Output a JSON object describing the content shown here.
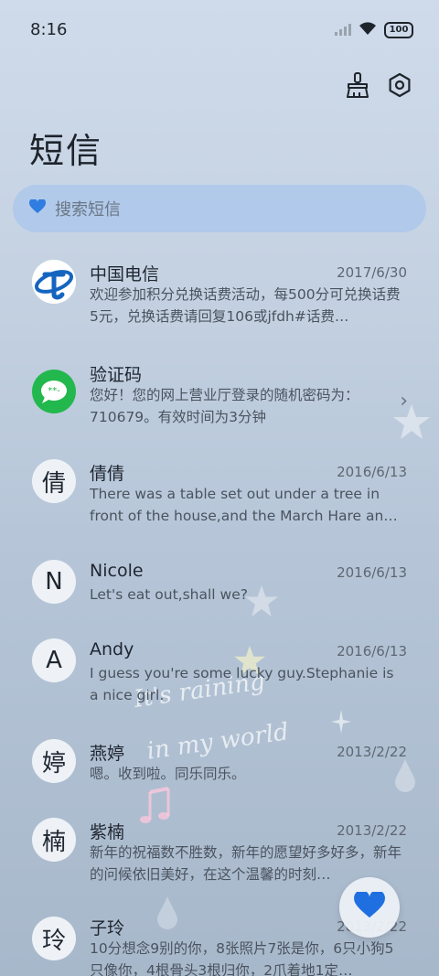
{
  "status_bar": {
    "time": "8:16",
    "battery": "100"
  },
  "header": {
    "title": "短信"
  },
  "search": {
    "placeholder": "搜索短信"
  },
  "decor": {
    "line1": "It's raining",
    "line2": "in my world"
  },
  "conversations": [
    {
      "name": "中国电信",
      "date": "2017/6/30",
      "preview": "欢迎参加积分兑换话费活动，每500分可兑换话费5元，兑换话费请回复106或jfdh#话费…",
      "avatar": ""
    },
    {
      "name": "验证码",
      "date": "",
      "preview": "您好！您的网上营业厅登录的随机密码为：710679。有效时间为3分钟",
      "avatar": ""
    },
    {
      "name": "倩倩",
      "date": "2016/6/13",
      "preview": "There was a table set out under a tree in front of the house,and the March Hare an…",
      "avatar": "倩"
    },
    {
      "name": "Nicole",
      "date": "2016/6/13",
      "preview": "Let's eat out,shall we?",
      "avatar": "N"
    },
    {
      "name": "Andy",
      "date": "2016/6/13",
      "preview": "I guess you're some lucky guy.Stephanie is a nice girl.",
      "avatar": "A"
    },
    {
      "name": "燕婷",
      "date": "2013/2/22",
      "preview": "嗯。收到啦。同乐同乐。",
      "avatar": "婷"
    },
    {
      "name": "紫楠",
      "date": "2013/2/22",
      "preview": "新年的祝福数不胜数，新年的愿望好多好多，新年的问候依旧美好，在这个温馨的时刻…",
      "avatar": "楠"
    },
    {
      "name": "子玲",
      "date": "2013/2/22",
      "preview": "10分想念9别的你，8张照片7张是你，6只小狗5只像你，4根骨头3根归你，2爪着地1定…",
      "avatar": "玲"
    }
  ]
}
